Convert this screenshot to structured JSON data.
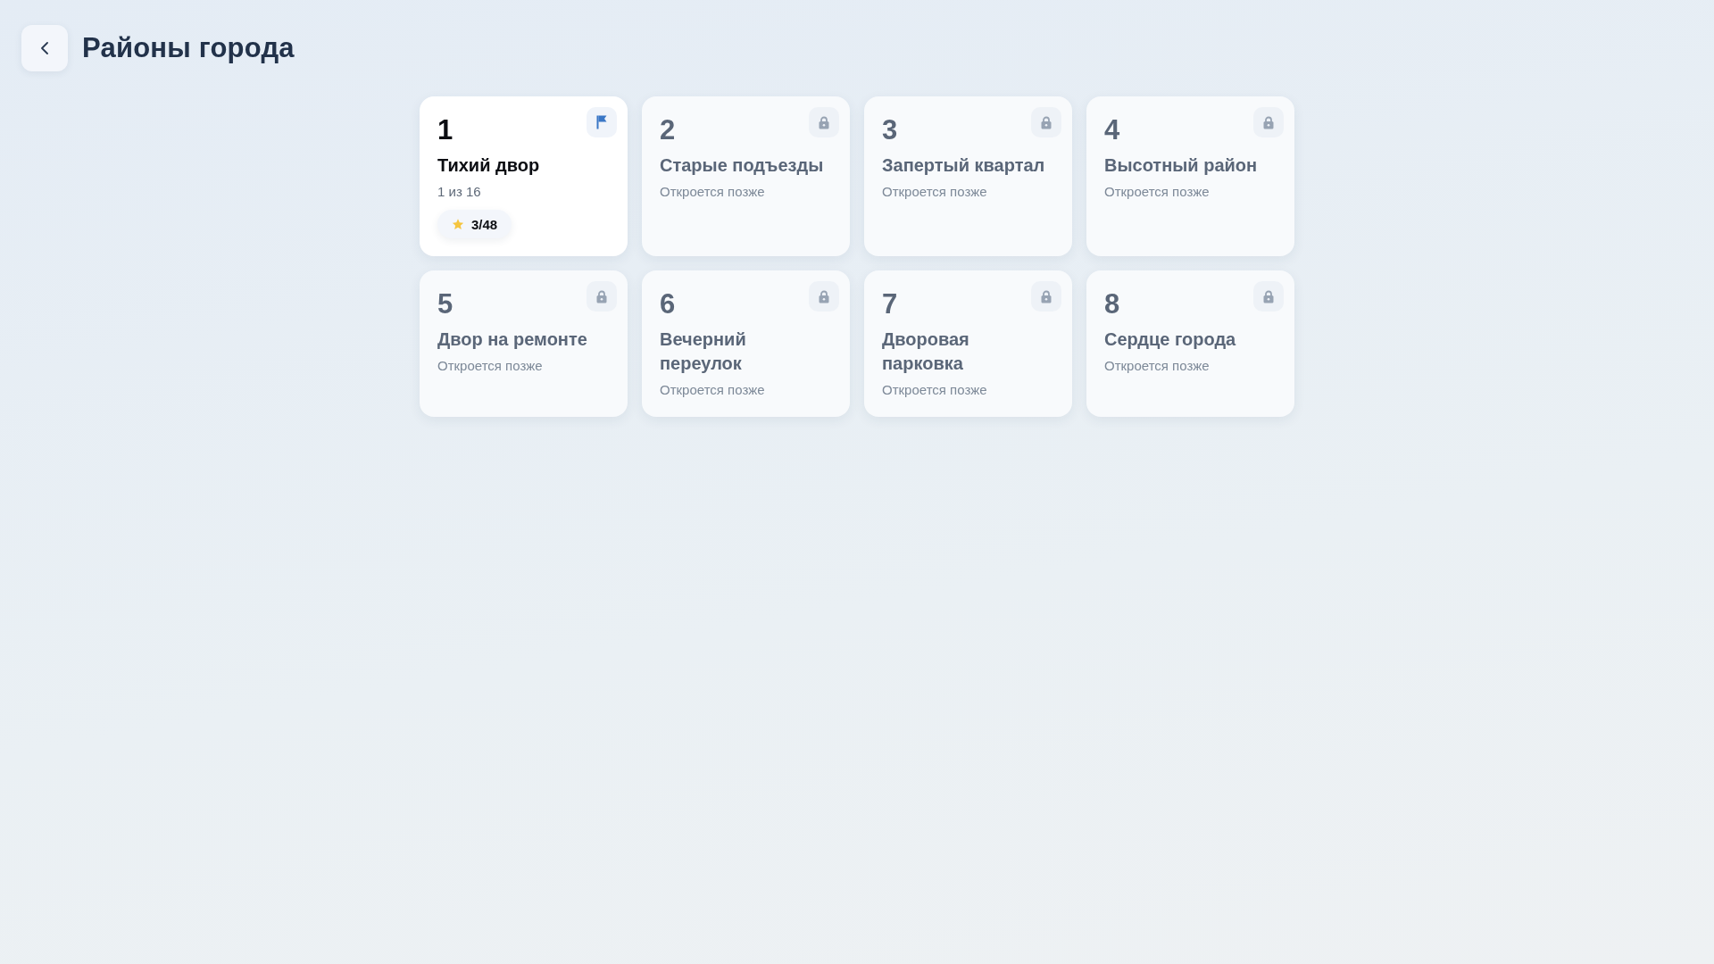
{
  "header": {
    "title": "Районы города"
  },
  "levels": [
    {
      "number": "1",
      "name": "Тихий двор",
      "subtitle": "1 из 16",
      "locked": false,
      "badge": "3/48"
    },
    {
      "number": "2",
      "name": "Старые подъезды",
      "subtitle": "Откроется позже",
      "locked": true
    },
    {
      "number": "3",
      "name": "Запертый квартал",
      "subtitle": "Откроется позже",
      "locked": true
    },
    {
      "number": "4",
      "name": "Высотный район",
      "subtitle": "Откроется позже",
      "locked": true
    },
    {
      "number": "5",
      "name": "Двор на ремонте",
      "subtitle": "Откроется позже",
      "locked": true
    },
    {
      "number": "6",
      "name": "Вечерний переулок",
      "subtitle": "Откроется позже",
      "locked": true
    },
    {
      "number": "7",
      "name": "Дворовая парковка",
      "subtitle": "Откроется позже",
      "locked": true
    },
    {
      "number": "8",
      "name": "Сердце города",
      "subtitle": "Откроется позже",
      "locked": true
    }
  ]
}
